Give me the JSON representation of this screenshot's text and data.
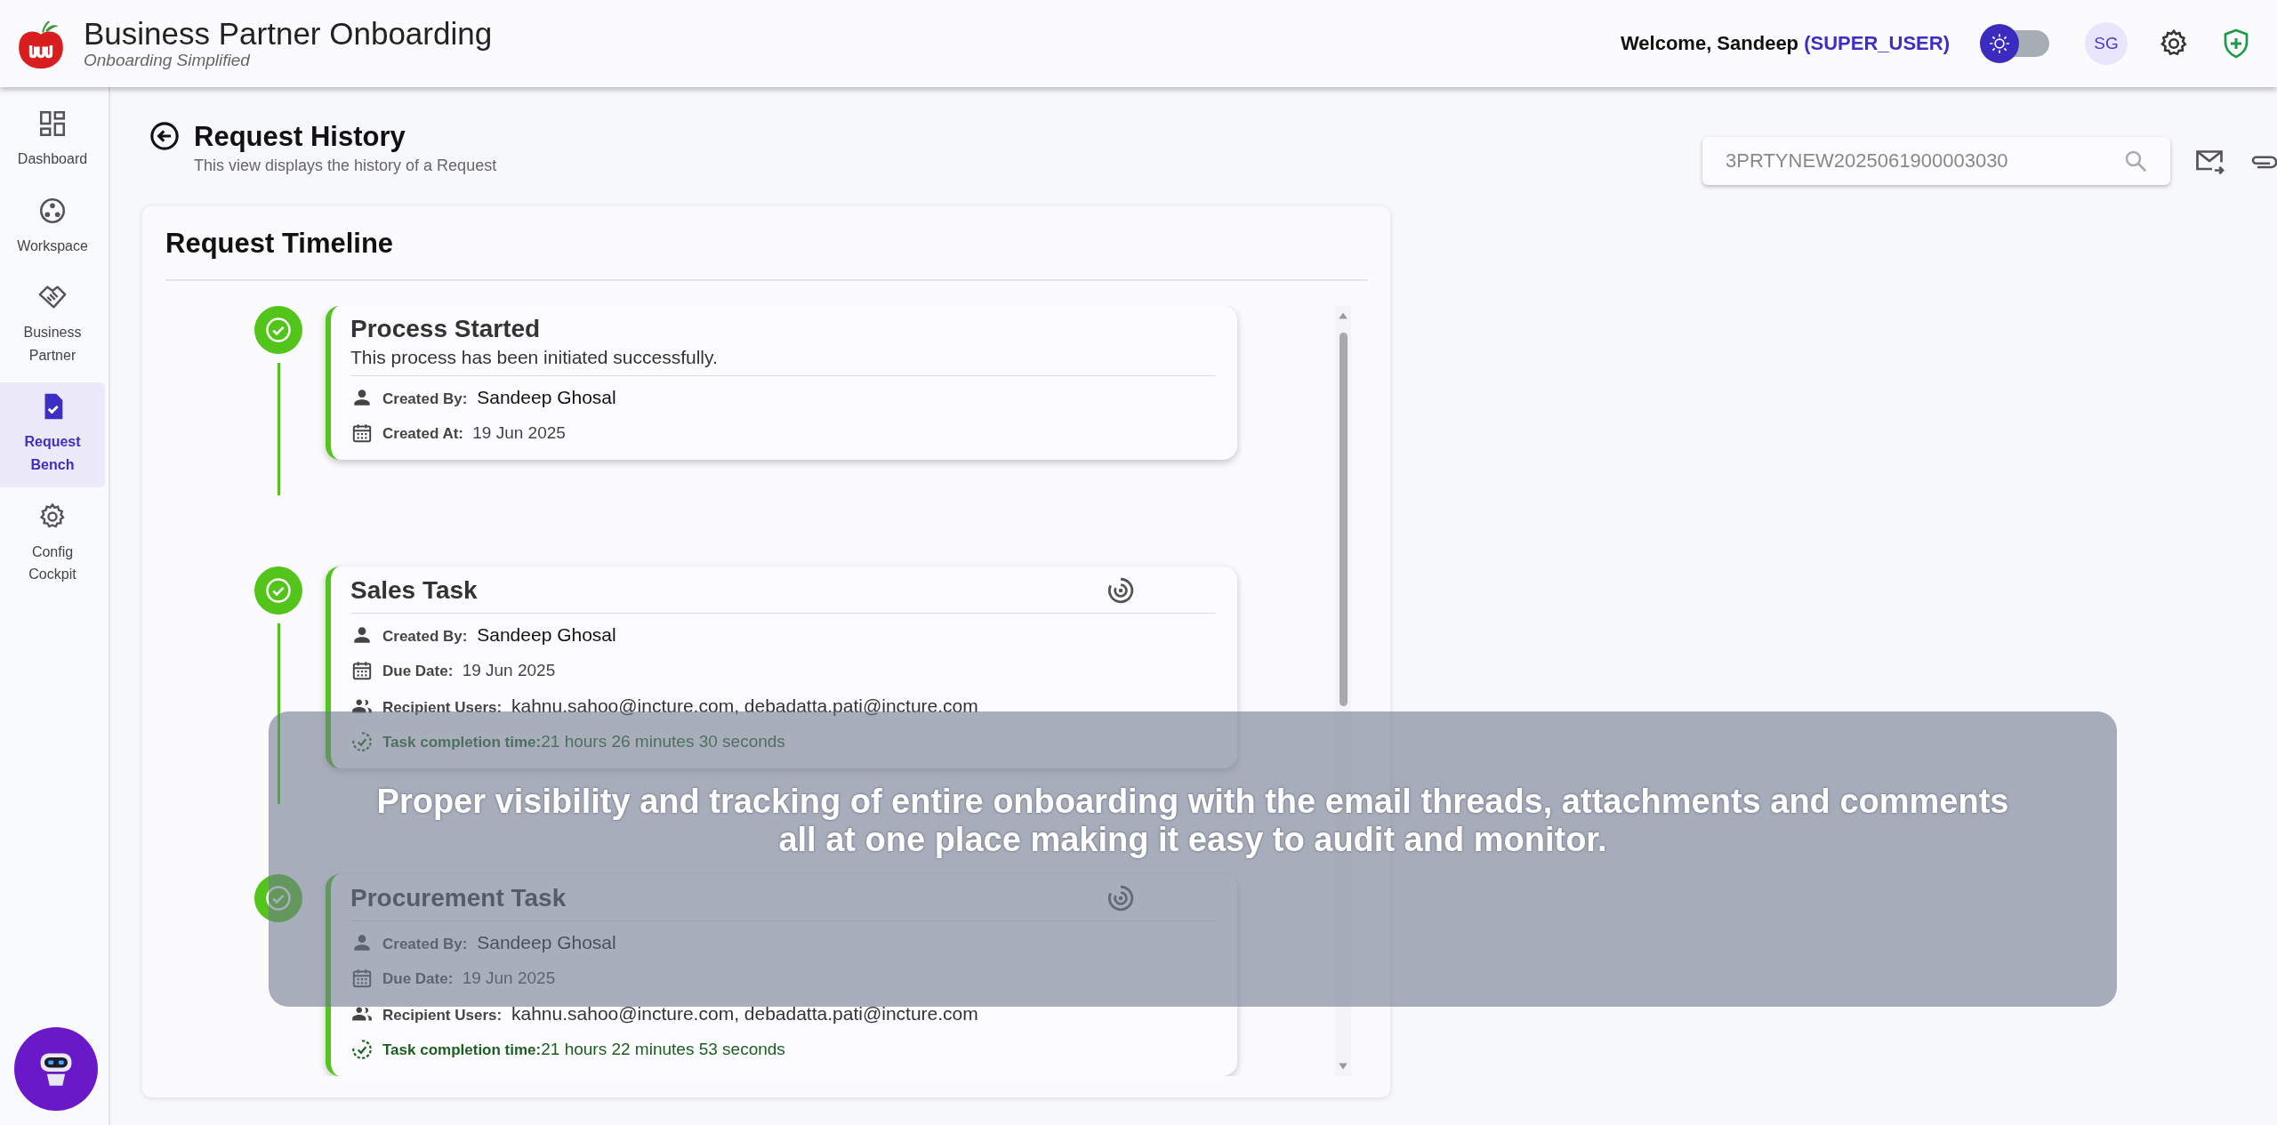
{
  "header": {
    "title": "Business Partner Onboarding",
    "subtitle": "Onboarding Simplified",
    "welcome": "Welcome, Sandeep",
    "role": "(SUPER_USER)",
    "theme_toggle": {
      "on": false
    },
    "avatar": "SG"
  },
  "sidebar": {
    "items": [
      {
        "kind": "dashboard",
        "label": "Dashboard",
        "selected": false
      },
      {
        "kind": "workspace",
        "label": "Workspace",
        "selected": false
      },
      {
        "kind": "partner",
        "label": "Business Partner",
        "selected": false
      },
      {
        "kind": "request",
        "label": "Request Bench",
        "selected": true
      },
      {
        "kind": "config",
        "label": "Config Cockpit",
        "selected": false
      }
    ]
  },
  "page": {
    "title": "Request History",
    "subtitle": "This view displays the history of a Request",
    "search": {
      "value": "3PRTYNEW2025061900003030"
    }
  },
  "timeline": {
    "title": "Request Timeline",
    "events": [
      {
        "kind": "start",
        "title": "Process Started",
        "description": "This process has been initiated successfully.",
        "completed": true,
        "fields": [
          {
            "kind": "person",
            "label": "Created By:",
            "value": "Sandeep Ghosal"
          },
          {
            "kind": "calendar",
            "label": "Created At:",
            "value": "19 Jun 2025"
          }
        ]
      },
      {
        "kind": "task",
        "title": "Sales Task",
        "completed": true,
        "fields": [
          {
            "kind": "person",
            "label": "Created By:",
            "value": "Sandeep Ghosal"
          },
          {
            "kind": "calendar",
            "label": "Due Date:",
            "value": "19 Jun 2025"
          },
          {
            "kind": "group",
            "label": "Recipient Users:",
            "value": "kahnu.sahoo@incture.com, debadatta.pati@incture.com"
          },
          {
            "kind": "timer",
            "label": "Task completion time:",
            "value": "21 hours 26 minutes 30 seconds"
          }
        ]
      },
      {
        "kind": "task",
        "title": "Procurement Task",
        "completed": true,
        "fields": [
          {
            "kind": "person",
            "label": "Created By:",
            "value": "Sandeep Ghosal"
          },
          {
            "kind": "calendar",
            "label": "Due Date:",
            "value": "19 Jun 2025"
          },
          {
            "kind": "group",
            "label": "Recipient Users:",
            "value": "kahnu.sahoo@incture.com, debadatta.pati@incture.com"
          },
          {
            "kind": "timer",
            "label": "Task completion time:",
            "value": "21 hours 22 minutes 53 seconds"
          }
        ]
      }
    ]
  },
  "caption": {
    "text": "Proper visibility and tracking of entire onboarding with the email threads, attachments and comments all at one place making it easy to audit and monitor."
  }
}
